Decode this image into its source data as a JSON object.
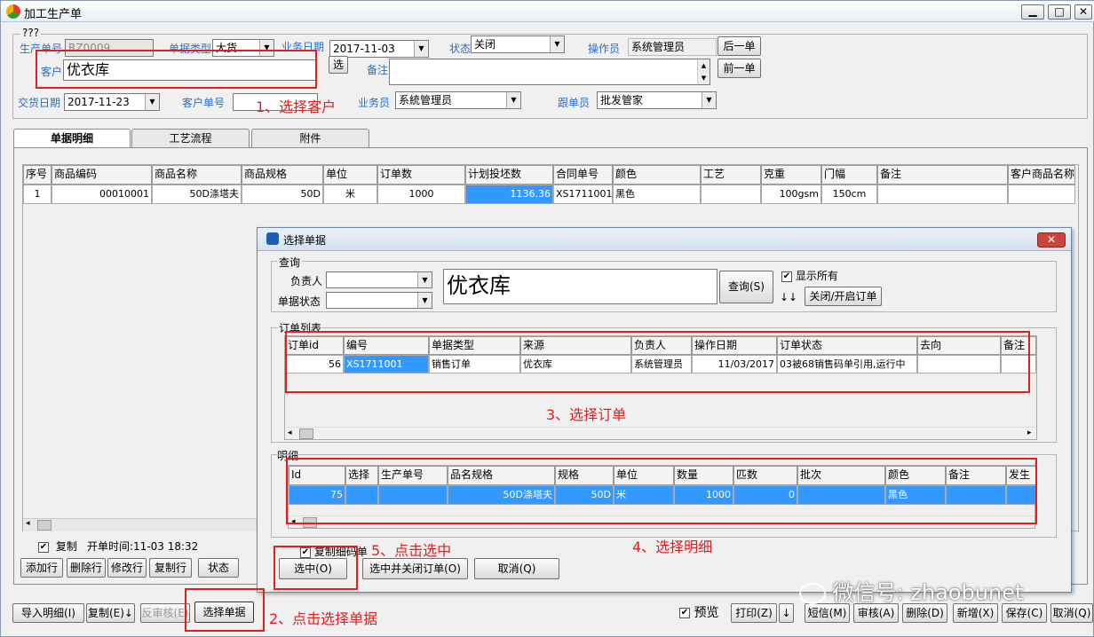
{
  "window": {
    "title": "加工生产单",
    "controls": [
      "▁",
      "□",
      "✕"
    ]
  },
  "group_title": "???",
  "header": {
    "prod_no_label": "生产单号",
    "prod_no_value": "RZ0009",
    "doc_type_label": "单据类型",
    "doc_type_value": "大货",
    "biz_date_label": "业务日期",
    "biz_date_value": "2017-11-03",
    "status_label": "状态",
    "status_value": "关闭",
    "operator_label": "操作员",
    "operator_value": "系统管理员",
    "next_btn": "后一单",
    "prev_btn": "前一单",
    "customer_label": "客户",
    "customer_value": "优衣库",
    "select_btn": "选",
    "remark_label": "备注",
    "delivery_label": "交货日期",
    "delivery_value": "2017-11-23",
    "cust_order_label": "客户单号",
    "salesman_label": "业务员",
    "salesman_value": "系統管理员",
    "follower_label": "跟单员",
    "follower_value": "批发管家"
  },
  "tabs": [
    "单据明细",
    "工艺流程",
    "附件"
  ],
  "grid": {
    "columns": [
      "序号",
      "商品编码",
      "商品名称",
      "商品规格",
      "单位",
      "订单数",
      "计划投坯数",
      "合同单号",
      "颜色",
      "工艺",
      "克重",
      "门幅",
      "备注",
      "客户商品名称"
    ],
    "rows": [
      [
        "1",
        "00010001",
        "50D涤塔夫",
        "50D",
        "米",
        "1000",
        "1136.36",
        "XS1711001",
        "黑色",
        "",
        "100gsm",
        "150cm",
        "",
        ""
      ]
    ]
  },
  "bottom_left": {
    "copy_label": "复制",
    "open_time": "开单时间:11-03 18:32",
    "add_row": "添加行",
    "del_row": "删除行",
    "edit_row": "修改行",
    "copy_row": "复制行",
    "state": "状态"
  },
  "footer": {
    "import": "导入明细(I)",
    "copy": "复制(E)↓",
    "unaudit": "反审核(E)",
    "select_doc": "选择单据",
    "preview": "预览",
    "print": "打印(Z)",
    "arrow": "↓",
    "sms": "短信(M)",
    "audit": "审核(A)",
    "delete": "删除(D)",
    "add": "新增(X)",
    "save": "保存(C)",
    "cancel": "取消(Q)"
  },
  "dialog": {
    "title": "选择单据",
    "query_group": "查询",
    "owner_label": "负责人",
    "doc_state_label": "单据状态",
    "search_value": "优衣库",
    "query_btn": "查询(S)",
    "show_all": "显示所有",
    "arrows": "↓↓",
    "close_open_btn": "关闭/开启订单",
    "order_list_label": "订单列表",
    "order_columns": [
      "订单id",
      "编号",
      "单据类型",
      "来源",
      "负责人",
      "操作日期",
      "订单状态",
      "去向",
      "备注"
    ],
    "order_rows": [
      [
        "56",
        "XS1711001",
        "销售订单",
        "优衣库",
        "系统管理员",
        "11/03/2017",
        "03被68销售码单引用,运行中",
        "",
        ""
      ]
    ],
    "detail_label": "明细",
    "detail_columns": [
      "Id",
      "选择",
      "生产单号",
      "品名规格",
      "规格",
      "单位",
      "数量",
      "匹数",
      "批次",
      "颜色",
      "备注",
      "发生"
    ],
    "detail_rows": [
      [
        "75",
        "",
        "",
        "50D涤塔夫",
        "50D",
        "米",
        "1000",
        "0",
        "",
        "黑色",
        "",
        ""
      ]
    ],
    "copy_detail": "复制细码单",
    "select_btn": "选中(O)",
    "select_close_btn": "选中并关闭订单(O)",
    "cancel_btn": "取消(Q)"
  },
  "annotations": {
    "a1": "1、选择客户",
    "a2": "2、点击选择单据",
    "a3": "3、选择订单",
    "a4": "4、选择明细",
    "a5": "5、点击选中"
  },
  "watermark": "微信号: zhaobunet",
  "colors": {
    "label_blue": "#2b6fc4",
    "selection_blue": "#3399ff",
    "annotation_red": "#e02020"
  }
}
